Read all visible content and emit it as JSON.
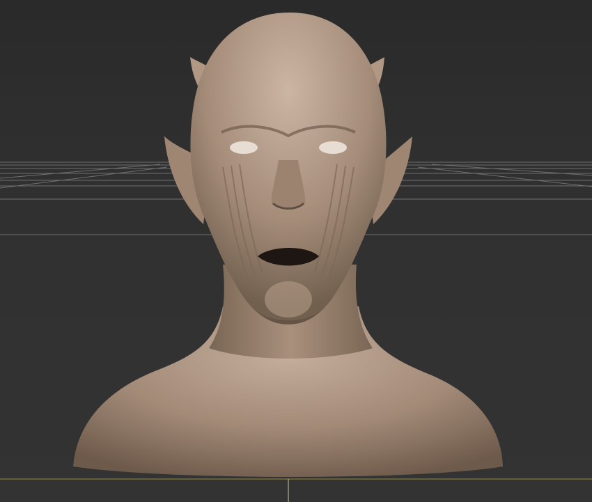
{
  "viewport": {
    "background_color": "#303030",
    "grid_color": "#8a8a8a",
    "floor_axis_color": "#a08a3a",
    "mesh": {
      "subject": "sculpted-bust",
      "material_color": "#a28a77",
      "shadow_color": "#5e4d40",
      "highlight_color": "#c7b19f"
    }
  }
}
